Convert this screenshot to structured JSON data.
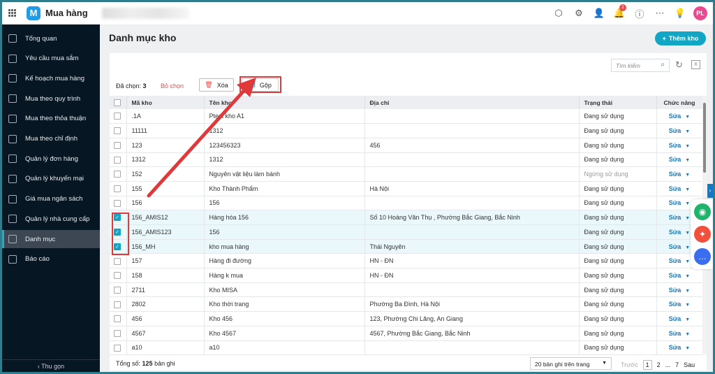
{
  "header": {
    "app_title": "Mua hàng",
    "logo_letter": "M",
    "notification_count": "1",
    "avatar_initials": "PL",
    "icons": [
      "apps-grid-icon",
      "package-search-icon",
      "gear-icon",
      "add-user-icon",
      "bell-icon",
      "help-icon",
      "more-icon",
      "ideas-icon"
    ]
  },
  "sidebar": {
    "items": [
      {
        "label": "Tổng quan"
      },
      {
        "label": "Yêu cầu mua sắm"
      },
      {
        "label": "Kế hoạch mua hàng"
      },
      {
        "label": "Mua theo quy trình"
      },
      {
        "label": "Mua theo thỏa thuận"
      },
      {
        "label": "Mua theo chỉ định"
      },
      {
        "label": "Quản lý đơn hàng"
      },
      {
        "label": "Quản lý khuyến mại"
      },
      {
        "label": "Giá mua ngân sách"
      },
      {
        "label": "Quản lý nhà cung cấp"
      },
      {
        "label": "Danh mục",
        "active": true
      },
      {
        "label": "Báo cáo"
      }
    ],
    "collapse": "‹  Thu gọn"
  },
  "page": {
    "title": "Danh mục kho",
    "add_button": "Thêm kho"
  },
  "toolbar": {
    "selected_label": "Đã chọn:",
    "selected_count": "3",
    "unselect": "Bỏ chọn",
    "delete": "Xóa",
    "merge": "Gộp",
    "search_placeholder": "Tìm kiếm"
  },
  "table": {
    "columns": [
      "Mã kho",
      "Tên kho",
      "Địa chỉ",
      "Trạng thái",
      "Chức năng"
    ],
    "edit_label": "Sửa",
    "rows": [
      {
        "code": ".1A",
        "name": "Ptest kho A1",
        "address": "",
        "status": "Đang sử dụng",
        "checked": false
      },
      {
        "code": "11111",
        "name": "1312",
        "address": "",
        "status": "Đang sử dụng",
        "checked": false
      },
      {
        "code": "123",
        "name": "123456323",
        "address": "456",
        "status": "Đang sử dụng",
        "checked": false
      },
      {
        "code": "1312",
        "name": "1312",
        "address": "",
        "status": "Đang sử dụng",
        "checked": false
      },
      {
        "code": "152",
        "name": "Nguyên vật liệu làm bánh",
        "address": "",
        "status": "Ngừng sử dụng",
        "checked": false
      },
      {
        "code": "155",
        "name": "Kho Thành Phẩm",
        "address": "Hà Nội",
        "status": "Đang sử dụng",
        "checked": false
      },
      {
        "code": "156",
        "name": "156",
        "address": "",
        "status": "Đang sử dụng",
        "checked": false
      },
      {
        "code": "156_AMIS12",
        "name": "Hàng hóa 156",
        "address": "Số 10 Hoàng Văn Thụ , Phường Bắc Giang, Bắc Ninh",
        "status": "Đang sử dụng",
        "checked": true
      },
      {
        "code": "156_AMIS123",
        "name": "156",
        "address": "",
        "status": "Đang sử dụng",
        "checked": true
      },
      {
        "code": "156_MH",
        "name": "kho mua hàng",
        "address": "Thái Nguyên",
        "status": "Đang sử dụng",
        "checked": true
      },
      {
        "code": "157",
        "name": "Hàng đi đường",
        "address": "HN - ĐN",
        "status": "Đang sử dụng",
        "checked": false
      },
      {
        "code": "158",
        "name": "Hàng k mua",
        "address": "HN - ĐN",
        "status": "Đang sử dụng",
        "checked": false
      },
      {
        "code": "2711",
        "name": "Kho MISA",
        "address": "",
        "status": "Đang sử dụng",
        "checked": false
      },
      {
        "code": "2802",
        "name": "Kho thời trang",
        "address": "Phường Ba Đình, Hà Nội",
        "status": "Đang sử dụng",
        "checked": false
      },
      {
        "code": "456",
        "name": "Kho 456",
        "address": "123, Phường Chi Lăng, An Giang",
        "status": "Đang sử dụng",
        "checked": false
      },
      {
        "code": "4567",
        "name": "Kho 4567",
        "address": "4567, Phường Bắc Giang, Bắc Ninh",
        "status": "Đang sử dụng",
        "checked": false
      },
      {
        "code": "a10",
        "name": "a10",
        "address": "",
        "status": "Đang sử dụng",
        "checked": false
      }
    ]
  },
  "footer": {
    "total_label": "Tổng số:",
    "total_count": "125",
    "total_suffix": "bản ghi",
    "page_size": "20 bản ghi trên trang",
    "prev": "Trước",
    "pages": [
      "1",
      "2",
      "...",
      "7"
    ],
    "next": "Sau"
  },
  "colors": {
    "accent": "#12a6c4",
    "annotation": "#e0393b",
    "sidebar": "#071623"
  }
}
